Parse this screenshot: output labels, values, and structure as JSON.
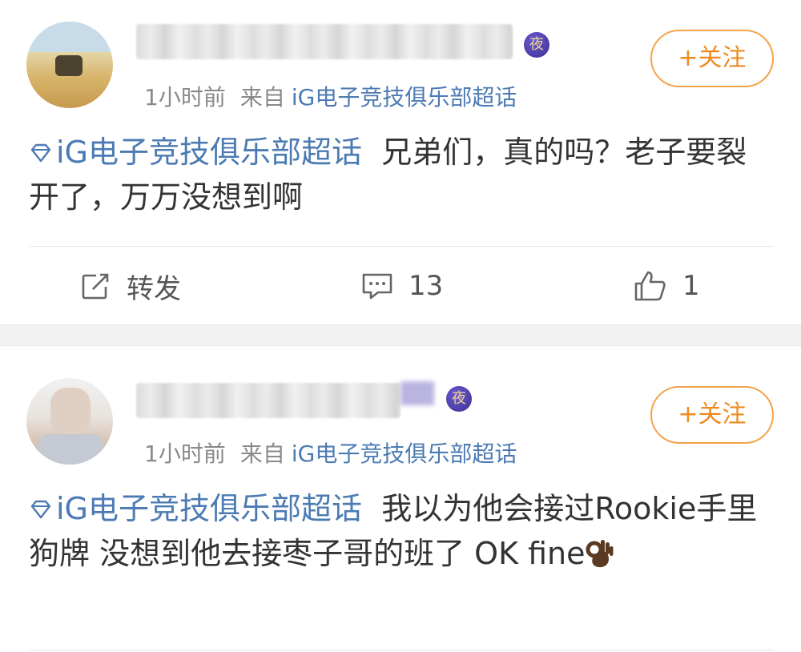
{
  "posts": [
    {
      "time": "1小时前",
      "source_prefix": "来自",
      "source_topic": "iG电子竞技俱乐部超话",
      "badge_char": "夜",
      "follow_label": "+关注",
      "topic_link": "iG电子竞技俱乐部超话",
      "text": "兄弟们，真的吗？老子要裂开了，万万没想到啊",
      "actions": {
        "repost_label": "转发",
        "comment_count": "13",
        "like_count": "1"
      }
    },
    {
      "time": "1小时前",
      "source_prefix": "来自",
      "source_topic": "iG电子竞技俱乐部超话",
      "badge_char": "夜",
      "follow_label": "+关注",
      "topic_link": "iG电子竞技俱乐部超话",
      "text": "我以为他会接过Rookie手里狗牌 没想到他去接枣子哥的班了 OK fine"
    }
  ],
  "icons": {
    "diamond": "super-topic-diamond-icon",
    "repost": "repost-icon",
    "comment": "comment-icon",
    "like": "thumbs-up-icon",
    "emoji": "ok-hand-emoji"
  },
  "colors": {
    "link": "#4c7bb3",
    "follow": "#ee8a1f",
    "meta": "#8a8a8a"
  }
}
